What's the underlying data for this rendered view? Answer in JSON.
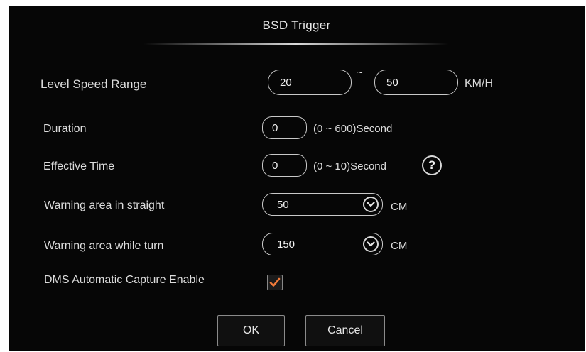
{
  "dialog": {
    "title": "BSD Trigger"
  },
  "level_speed": {
    "label": "Level Speed Range",
    "min_value": "20",
    "separator": "~",
    "max_value": "50",
    "unit": "KM/H"
  },
  "duration": {
    "label": "Duration",
    "value": "0",
    "range_text": "(0 ~ 600)Second"
  },
  "effective_time": {
    "label": "Effective Time",
    "value": "0",
    "range_text": "(0 ~ 10)Second",
    "help_symbol": "?"
  },
  "warning_straight": {
    "label": "Warning area in straight",
    "value": "50",
    "unit": "CM"
  },
  "warning_turn": {
    "label": "Warning area while turn",
    "value": "150",
    "unit": "CM"
  },
  "dms_capture": {
    "label": "DMS Automatic Capture Enable",
    "checked": true
  },
  "buttons": {
    "ok": "OK",
    "cancel": "Cancel"
  },
  "colors": {
    "background": "#060606",
    "text": "#dcdcdc",
    "check_accent": "#f07a3a"
  },
  "icons": {
    "help": "help-icon",
    "dropdown": "chevron-down-icon",
    "check": "checkmark-icon"
  }
}
